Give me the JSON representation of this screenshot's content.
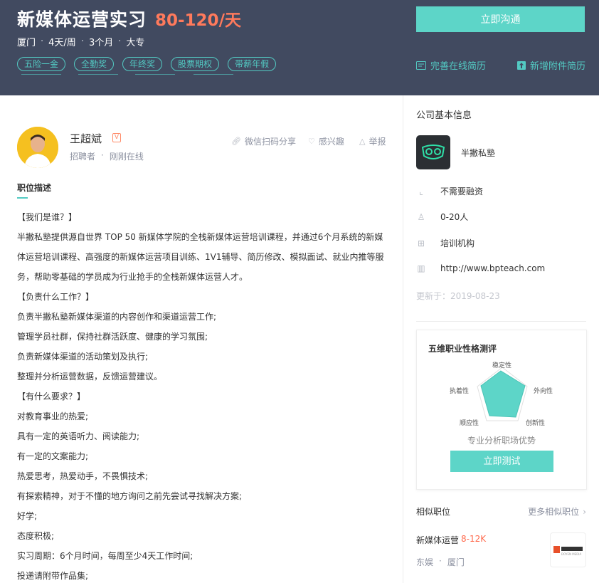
{
  "job": {
    "title": "新媒体运营实习",
    "salary": "80-120/天",
    "meta": [
      "厦门",
      "4天/周",
      "3个月",
      "大专"
    ],
    "tags": [
      "五险一金",
      "全勤奖",
      "年终奖",
      "股票期权",
      "带薪年假"
    ]
  },
  "header_actions": {
    "chat_button": "立即沟通",
    "complete_resume": "完善在线简历",
    "add_attachment": "新增附件简历"
  },
  "recruiter": {
    "name": "王超斌",
    "role": "招聘者",
    "status": "刚刚在线",
    "badge": "V"
  },
  "post_actions": {
    "share": "微信扫码分享",
    "interest": "感兴趣",
    "report": "举报"
  },
  "description": {
    "section_title": "职位描述",
    "lines": [
      "【我们是谁？】",
      "半撇私塾提供源自世界 TOP 50 新媒体学院的全栈新媒体运营培训课程，并通过6个月系统的新媒",
      "体运营培训课程、高强度的新媒体运营项目训练、1V1辅导、简历修改、模拟面试、就业内推等服",
      "务，帮助零基础的学员成为行业抢手的全栈新媒体运营人才。",
      "【负责什么工作？】",
      "负责半撇私塾新媒体渠道的内容创作和渠道运营工作;",
      "管理学员社群，保持社群活跃度、健康的学习氛围;",
      "负责新媒体渠道的活动策划及执行;",
      "整理并分析运营数据，反馈运营建议。",
      "【有什么要求？】",
      "对教育事业的热爱;",
      "具有一定的英语听力、阅读能力;",
      "有一定的文案能力;",
      "热爱思考，热爱动手，不畏惧技术;",
      "有探索精神，对于不懂的地方询问之前先尝试寻找解决方案;",
      "好学;",
      "态度积极;",
      "实习周期：6个月时间，每周至少4天工作时间;",
      "投递请附带作品集;"
    ]
  },
  "company": {
    "section_title": "公司基本信息",
    "name": "半撇私塾",
    "funding": "不需要融资",
    "size": "0-20人",
    "industry": "培训机构",
    "website": "http://www.bpteach.com",
    "updated": "更新于：2019-08-23"
  },
  "personality_test": {
    "title": "五维职业性格测评",
    "dimensions": [
      "稳定性",
      "外向性",
      "创新性",
      "顺应性",
      "执着性"
    ],
    "subtitle": "专业分析职场优势",
    "button": "立即测试"
  },
  "similar": {
    "title": "相似职位",
    "more": "更多相似职位",
    "job_title": "新媒体运营",
    "job_salary": "8-12K",
    "company": "东娱",
    "city": "厦门",
    "logo_text": "DOYEN MEDIA"
  },
  "colors": {
    "header_bg": "#414a60",
    "accent": "#5dd5c8",
    "salary": "#ff7a5c"
  }
}
